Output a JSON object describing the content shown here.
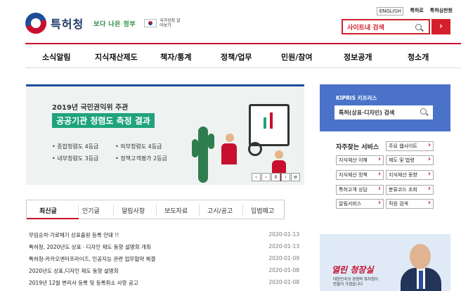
{
  "header": {
    "logo_text": "특허청",
    "slogan": "보다 나은 정부",
    "flag_caption": "국가상징 알아보기",
    "top_links": [
      "ENGLISH",
      "특허로",
      "특허심판원"
    ],
    "search_placeholder": "사이트내 검색",
    "search_go": "›"
  },
  "gnb": [
    "소식알림",
    "지식재산제도",
    "책자/통계",
    "정책/업무",
    "민원/참여",
    "정보공개",
    "청소개"
  ],
  "banner": {
    "subtitle": "2019년 국민권익위 주관",
    "title": "공공기관 청렴도 측정 결과",
    "items": [
      "• 종합청렴도 4등급",
      "• 외부청렴도 4등급",
      "• 내부청렴도 3등급",
      "• 정책고객평가 2등급"
    ],
    "controls": [
      "‹",
      "›",
      "Ⅱ",
      "›",
      "≡"
    ]
  },
  "tabs": [
    "최신글",
    "인기글",
    "알림사항",
    "보도자료",
    "고시/공고",
    "입법예고"
  ],
  "news": [
    {
      "title": "무임승차·가로채기 상표출원 등록 안돼 !!",
      "date": "2020-01-13"
    },
    {
      "title": "특허청, 2020년도 상표ㆍ디자인 제도 동향 설명회 개최",
      "date": "2020-01-13"
    },
    {
      "title": "특허청-카카오엔터프라이즈, 인공지능 관련 업무협약 체결",
      "date": "2020-01-09"
    },
    {
      "title": "2020년도 상표,디자인 제도 동향 설명회",
      "date": "2020-01-08"
    },
    {
      "title": "2019년 12월 변리사 등록 및 등록취소 사항 공고",
      "date": "2020-01-08"
    }
  ],
  "kipris": {
    "title": "KIPRIS 키프리스",
    "search_label": "특허(상표·디자인) 검색"
  },
  "services": {
    "title": "자주찾는 서비스",
    "items": [
      "주요 웹사이트",
      "지식재산 이해",
      "제도 및 법령",
      "지식재산 정책",
      "지식재산 동향",
      "특허고객 상담",
      "분류코드 조회",
      "알림서비스",
      "직원 검색"
    ]
  },
  "ceo": {
    "title": "열린 청장실",
    "caption": "대한민국의 경쟁력 특허청이 만들어 가겠습니다"
  }
}
